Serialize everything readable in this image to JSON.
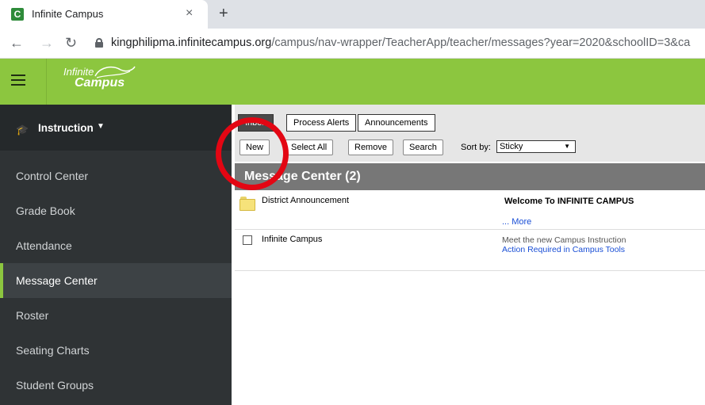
{
  "browser": {
    "tab_title": "Infinite Campus",
    "tab_favicon_letter": "C",
    "close_glyph": "×",
    "new_tab_glyph": "+",
    "url_host": "kingphilipma.infinitecampus.org",
    "url_path": "/campus/nav-wrapper/TeacherApp/teacher/messages?year=2020&schoolID=3&ca"
  },
  "header": {
    "logo_line1": "Infinite",
    "logo_line2": "Campus",
    "accent_color": "#8cc63f"
  },
  "sidebar": {
    "section_label": "Instruction",
    "items": [
      {
        "label": "Control Center"
      },
      {
        "label": "Grade Book"
      },
      {
        "label": "Attendance"
      },
      {
        "label": "Message Center",
        "active": true
      },
      {
        "label": "Roster"
      },
      {
        "label": "Seating Charts"
      },
      {
        "label": "Student Groups"
      }
    ]
  },
  "main": {
    "tabs": [
      {
        "label": "Inbox",
        "selected": true
      },
      {
        "label": "Process Alerts"
      },
      {
        "label": "Announcements"
      }
    ],
    "actions": {
      "new": "New",
      "select_all": "Select All",
      "remove": "Remove",
      "search": "Search"
    },
    "sort_label": "Sort by:",
    "sort_value": "Sticky",
    "header_title": "Message Center (2)",
    "messages": [
      {
        "sender": "District Announcement",
        "subject": "Welcome To INFINITE CAMPUS",
        "more": "... More"
      },
      {
        "sender": "Infinite Campus",
        "line1": "Meet the new Campus Instruction",
        "line2": "Action Required in Campus Tools"
      }
    ],
    "annotation_color": "#e30613"
  }
}
